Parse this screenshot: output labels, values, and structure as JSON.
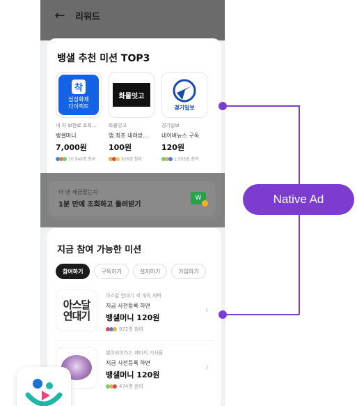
{
  "appbar": {
    "title": "리워드"
  },
  "top_missions": {
    "title": "뱅샐 추천 미션 TOP3",
    "items": [
      {
        "logo_lines": [
          "착",
          "삼성화재",
          "다이렉트"
        ],
        "desc": "내 차 보험료 조회...",
        "reward": "뱅샐머니",
        "price": "7,000원",
        "participants": "10,948명 참여"
      },
      {
        "logo_lines": [
          "화물잇고"
        ],
        "desc": "화물잇고",
        "reward": "앱 최초 내려받...",
        "price": "100원",
        "participants": "926명 참여"
      },
      {
        "logo_lines": [
          "경기일보"
        ],
        "desc": "경기일보",
        "reward": "네이버뉴스 구독",
        "price": "120원",
        "participants": "1,595명 참여"
      }
    ]
  },
  "banner": {
    "sub": "더 낸 세금있는지",
    "main": "1분 만에 조회하고 돌려받기"
  },
  "available": {
    "title": "지금 참여 가능한 미션",
    "chips": [
      "참여하기",
      "구독하기",
      "설치하기",
      "가입하기"
    ],
    "items": [
      {
        "logo_lines": [
          "아스달",
          "연대기"
        ],
        "sub": "아스달 연대기 세 개의 세력",
        "desc": "지금 사전등록 하면",
        "price": "뱅샐머니 120원",
        "participants": "972명 참여"
      },
      {
        "sub": "별이되어라2: 베다의 기사들",
        "desc": "지금 사전등록 하면",
        "price": "뱅샐머니 120원",
        "participants": "474명 참여"
      }
    ]
  },
  "annotation": {
    "label": "Native Ad",
    "color": "#7b3ccf"
  }
}
